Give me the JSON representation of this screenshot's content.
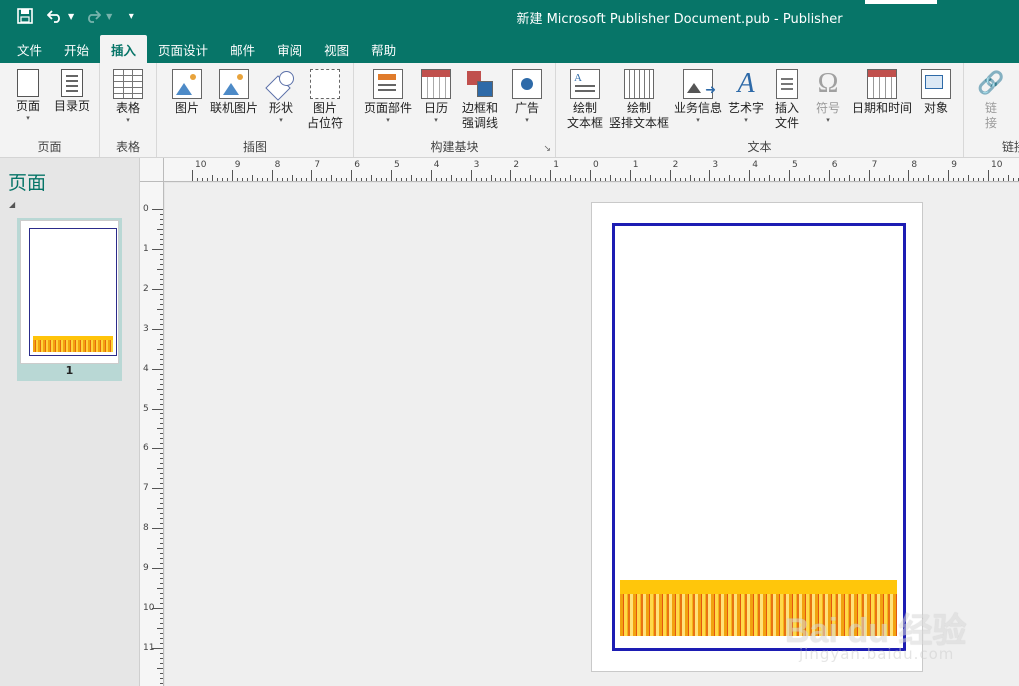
{
  "titlebar": {
    "title": "新建 Microsoft Publisher Document.pub  -  Publisher"
  },
  "tabs": [
    {
      "label": "文件"
    },
    {
      "label": "开始"
    },
    {
      "label": "插入"
    },
    {
      "label": "页面设计"
    },
    {
      "label": "邮件"
    },
    {
      "label": "审阅"
    },
    {
      "label": "视图"
    },
    {
      "label": "帮助"
    }
  ],
  "ribbon": {
    "groups": {
      "pages": "页面",
      "tables": "表格",
      "illustrations": "插图",
      "building_blocks": "构建基块",
      "text": "文本",
      "links": "链接"
    },
    "buttons": {
      "page": "页面",
      "toc": "目录页",
      "table": "表格",
      "picture": "图片",
      "online_picture": "联机图片",
      "shapes": "形状",
      "picture_placeholder_1": "图片",
      "picture_placeholder_2": "占位符",
      "page_parts": "页面部件",
      "calendar": "日历",
      "borders_1": "边框和",
      "borders_2": "强调线",
      "ad": "广告",
      "draw_textbox_1": "绘制",
      "draw_textbox_2": "文本框",
      "draw_vtextbox_1": "绘制",
      "draw_vtextbox_2": "竖排文本框",
      "business_info": "业务信息",
      "wordart": "艺术字",
      "insert_file_1": "插入",
      "insert_file_2": "文件",
      "symbol": "符号",
      "date_time": "日期和时间",
      "object": "对象",
      "link_1": "链",
      "link_2": "接"
    },
    "wordart_glyph": "A",
    "symbol_glyph": "Ω"
  },
  "sidebar": {
    "title": "页面",
    "pages": [
      {
        "number": "1"
      }
    ]
  },
  "rulers": {
    "horizontal": [
      "10",
      "9",
      "8",
      "7",
      "6",
      "5",
      "4",
      "3",
      "2",
      "1",
      "0",
      "1",
      "2",
      "3",
      "4",
      "5",
      "6",
      "7",
      "8",
      "9",
      "10"
    ],
    "vertical": [
      "0",
      "1",
      "2",
      "3",
      "4",
      "5",
      "6",
      "7",
      "8",
      "9",
      "10",
      "11"
    ]
  },
  "watermark": {
    "text": "Bai du 经验",
    "sub": "jingyan.baidu.com"
  }
}
